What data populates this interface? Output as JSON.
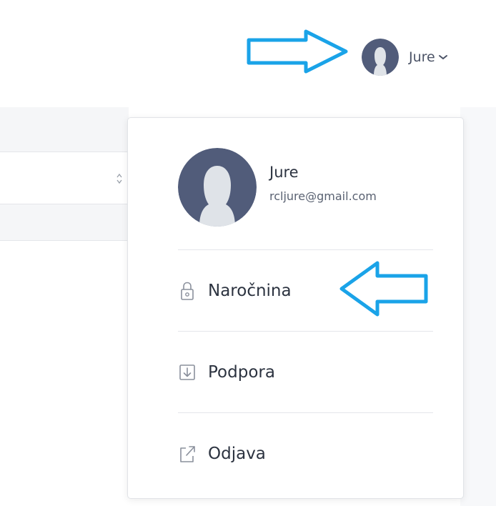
{
  "header": {
    "user_name": "Jure"
  },
  "dropdown": {
    "profile": {
      "name": "Jure",
      "email": "rcljure@gmail.com"
    },
    "items": [
      {
        "label": "Naročnina",
        "icon": "lock-icon"
      },
      {
        "label": "Podpora",
        "icon": "download-icon"
      },
      {
        "label": "Odjava",
        "icon": "external-link-icon"
      }
    ]
  },
  "colors": {
    "avatar_bg": "#515c7a",
    "avatar_figure": "#dfe3e8",
    "annotation_arrow": "#1aa3e8",
    "icon_gray": "#8a909c"
  }
}
